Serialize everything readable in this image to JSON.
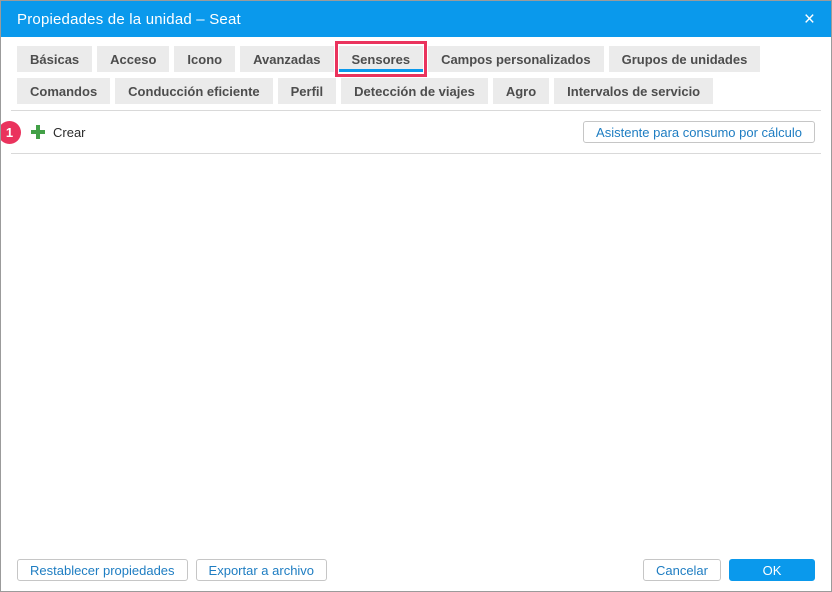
{
  "dialog": {
    "title": "Propiedades de la unidad – Seat",
    "close_icon": "×"
  },
  "tabs": {
    "row1": [
      {
        "label": "Básicas"
      },
      {
        "label": "Acceso"
      },
      {
        "label": "Icono"
      },
      {
        "label": "Avanzadas"
      },
      {
        "label": "Sensores",
        "active": true,
        "annotated": true
      },
      {
        "label": "Campos personalizados"
      },
      {
        "label": "Grupos de unidades"
      }
    ],
    "row2": [
      {
        "label": "Comandos"
      },
      {
        "label": "Conducción eficiente"
      },
      {
        "label": "Perfil"
      },
      {
        "label": "Detección de viajes"
      },
      {
        "label": "Agro"
      },
      {
        "label": "Intervalos de servicio"
      }
    ]
  },
  "sensors_toolbar": {
    "annotation_number": "1",
    "create_label": "Crear",
    "plus_icon": "plus",
    "wizard_button_label": "Asistente para consumo por cálculo"
  },
  "footer": {
    "reset_label": "Restablecer propiedades",
    "export_label": "Exportar a archivo",
    "cancel_label": "Cancelar",
    "ok_label": "OK"
  },
  "colors": {
    "header_blue": "#0a99ec",
    "annotation_red": "#ea335d",
    "plus_green": "#43a047",
    "button_text_blue": "#1e7dc2",
    "tab_background": "#ebebeb"
  }
}
